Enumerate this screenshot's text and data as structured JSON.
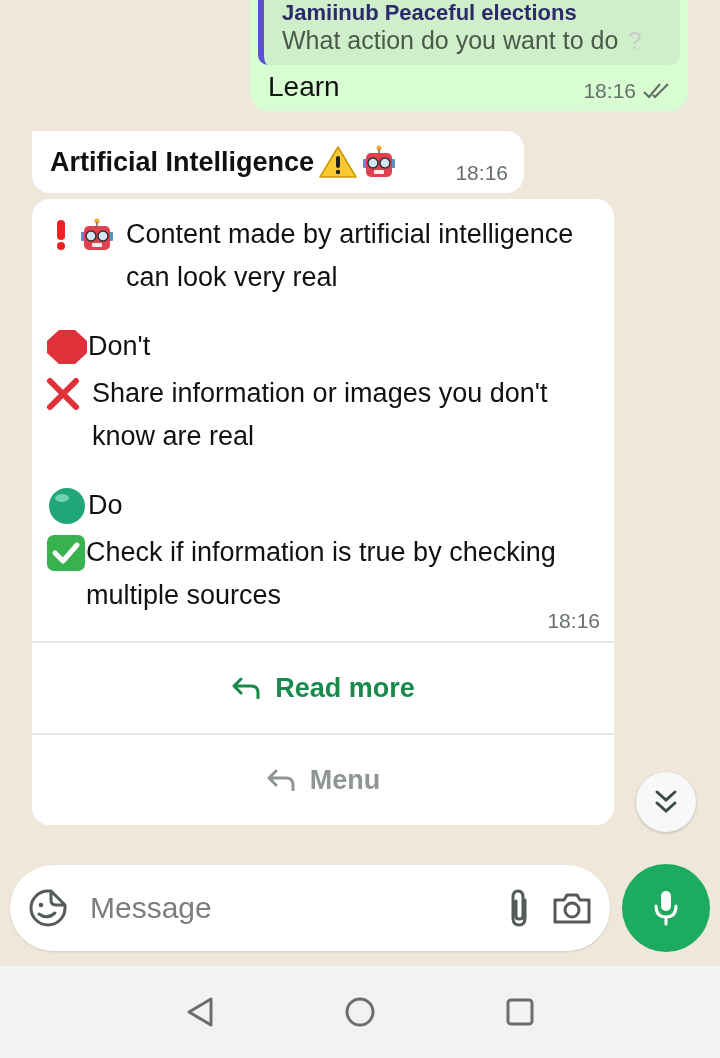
{
  "sent_message": {
    "quote": {
      "title": "Jamiinub Peaceful elections",
      "text": "What action do you want to do",
      "mark": "?"
    },
    "text": "Learn",
    "time": "18:16",
    "read": true
  },
  "header_message": {
    "text": "Artificial Intelligence",
    "time": "18:16"
  },
  "info_message": {
    "sections": [
      [
        {
          "kind": "alert",
          "text": "Content made by artificial intelligence can look very real"
        }
      ],
      [
        {
          "kind": "dont",
          "text": "Don't"
        },
        {
          "kind": "cross",
          "text": "Share information or images you don't know are real"
        }
      ],
      [
        {
          "kind": "do",
          "text": "Do"
        },
        {
          "kind": "check",
          "text": "Check if information is true by checking multiple sources"
        }
      ]
    ],
    "time": "18:16",
    "buttons": [
      {
        "label": "Read more",
        "disabled": false
      },
      {
        "label": "Menu",
        "disabled": true
      }
    ]
  },
  "composer": {
    "placeholder": "Message"
  }
}
